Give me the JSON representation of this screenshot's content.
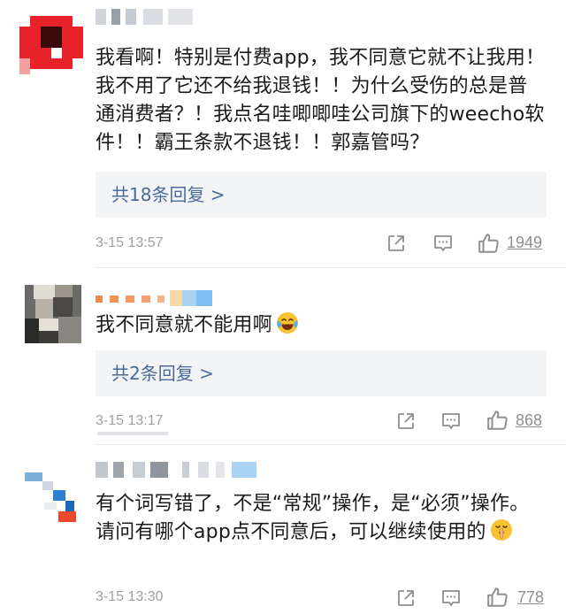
{
  "comments": [
    {
      "text": "我看啊！特别是付费app，我不同意它就不让我用！我不用了它还不给我退钱！！为什么受伤的总是普通消费者？！我点名哇唧唧哇公司旗下的weecho软件！！霸王条款不退钱！！郭嘉管吗？",
      "reply_label": "共18条回复 >",
      "time": "3-15 13:57",
      "likes": "1949"
    },
    {
      "text": "我不同意就不能用啊",
      "emoji": "laughing-crying-emoji",
      "reply_label": "共2条回复 >",
      "time": "3-15 13:17",
      "likes": "868"
    },
    {
      "text": "有个词写错了，不是“常规”操作，是“必须”操作。请问有哪个app点不同意后，可以继续使用的",
      "emoji": "shushing-face-emoji",
      "time": "3-15 13:30",
      "likes": "778"
    }
  ],
  "icons": {
    "share": "share-icon",
    "comment": "comment-icon",
    "like": "thumbs-up-icon"
  },
  "colors": {
    "reply_link": "#4a6a9a",
    "reply_bg": "#f3f4f6",
    "meta_text": "#a0a0a0"
  }
}
